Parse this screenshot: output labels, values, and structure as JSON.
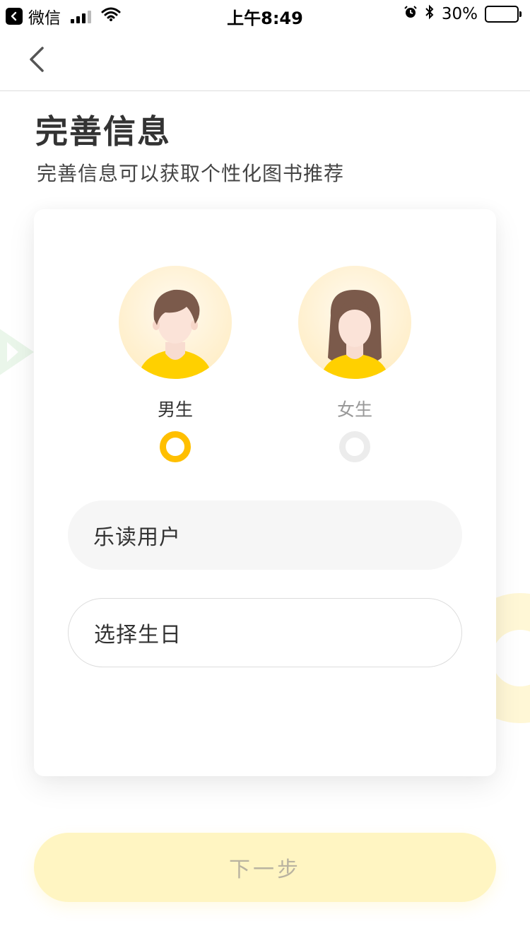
{
  "status_bar": {
    "app": "微信",
    "time": "上午8:49",
    "battery": "30%",
    "battery_level": 0.3
  },
  "page": {
    "title": "完善信息",
    "subtitle": "完善信息可以获取个性化图书推荐"
  },
  "gender": {
    "male_label": "男生",
    "female_label": "女生",
    "selected": "male"
  },
  "form": {
    "nickname_value": "乐读用户",
    "birthday_placeholder": "选择生日"
  },
  "next_button": {
    "label": "下一步"
  },
  "colors": {
    "accent": "#ffbf00",
    "button_disabled": "#fff5c2",
    "avatar_bg": "#fff6df",
    "shirt": "#ffd000"
  },
  "icons": [
    "back-app-icon",
    "signal-icon",
    "wifi-icon",
    "alarm-icon",
    "bluetooth-icon",
    "battery-icon",
    "back-arrow-icon"
  ]
}
